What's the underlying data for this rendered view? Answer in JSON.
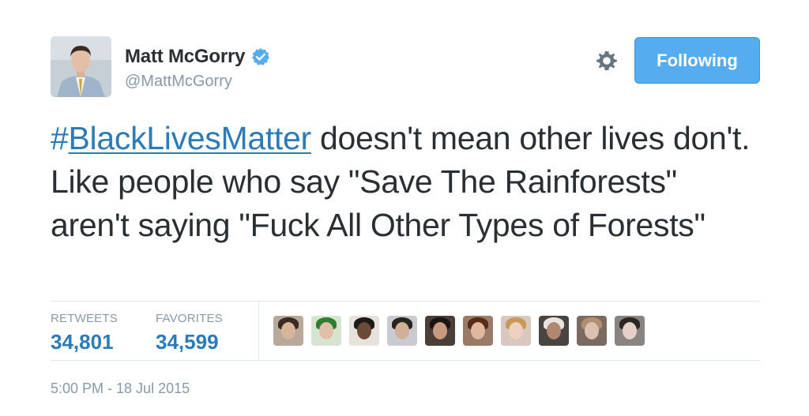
{
  "user": {
    "display_name": "Matt McGorry",
    "screen_name": "@MattMcGorry",
    "verified_icon": "verified-badge-icon",
    "avatar_icon": "profile-photo"
  },
  "actions": {
    "settings_icon": "gear-icon",
    "follow_label": "Following"
  },
  "tweet": {
    "hash": "#",
    "hashtag": "BlackLivesMatter",
    "text_line1_rest": " doesn't mean other lives",
    "text_rest": "don't. Like people who say \"Save The Rainforests\" aren't saying \"Fuck All Other Types of Forests\""
  },
  "stats": {
    "retweets_label": "RETWEETS",
    "retweets_value": "34,801",
    "favorites_label": "FAVORITES",
    "favorites_value": "34,599"
  },
  "favoriters_count_shown": 10,
  "timestamp": "5:00 PM - 18 Jul 2015",
  "colors": {
    "link": "#2b7bb9",
    "button": "#55acee",
    "muted": "#8899a6",
    "text": "#292f33",
    "divider": "#e1e8ed"
  }
}
